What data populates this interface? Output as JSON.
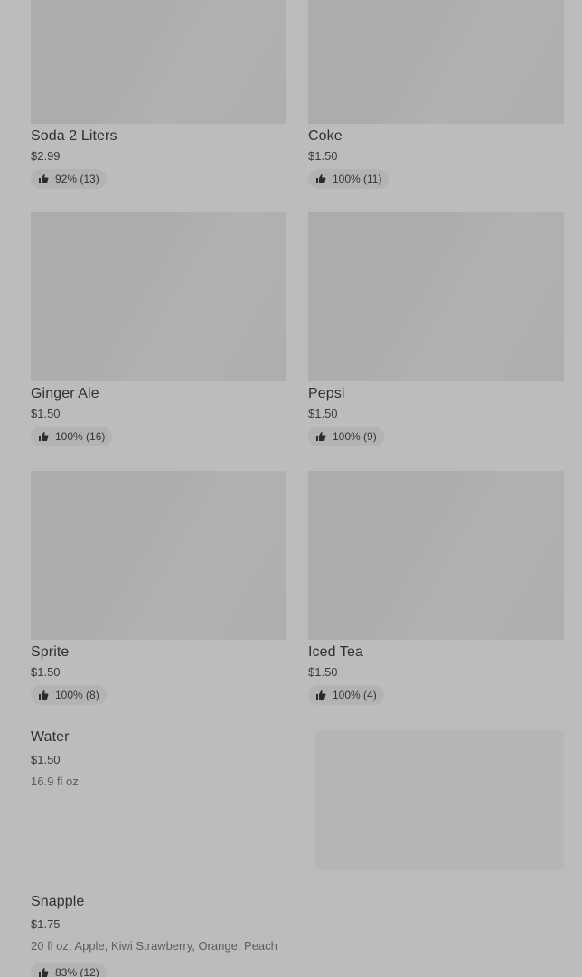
{
  "grid_items": [
    {
      "name": "Soda 2 Liters",
      "price": "$2.99",
      "rating": "92% (13)"
    },
    {
      "name": "Coke",
      "price": "$1.50",
      "rating": "100% (11)"
    },
    {
      "name": "Ginger Ale",
      "price": "$1.50",
      "rating": "100% (16)"
    },
    {
      "name": "Pepsi",
      "price": "$1.50",
      "rating": "100% (9)"
    },
    {
      "name": "Sprite",
      "price": "$1.50",
      "rating": "100% (8)"
    },
    {
      "name": "Iced Tea",
      "price": "$1.50",
      "rating": "100% (4)"
    }
  ],
  "list_items": [
    {
      "name": "Water",
      "price": "$1.50",
      "description": "16.9 fl oz"
    },
    {
      "name": "Snapple",
      "price": "$1.75",
      "description": "20 fl oz, Apple, Kiwi Strawberry, Orange, Peach",
      "rating": "83% (12)"
    }
  ],
  "icons": {
    "rating": "thumbs-up-icon"
  },
  "colors": {
    "overlay_background": "#bcbcbc",
    "placeholder": "#acacac"
  }
}
